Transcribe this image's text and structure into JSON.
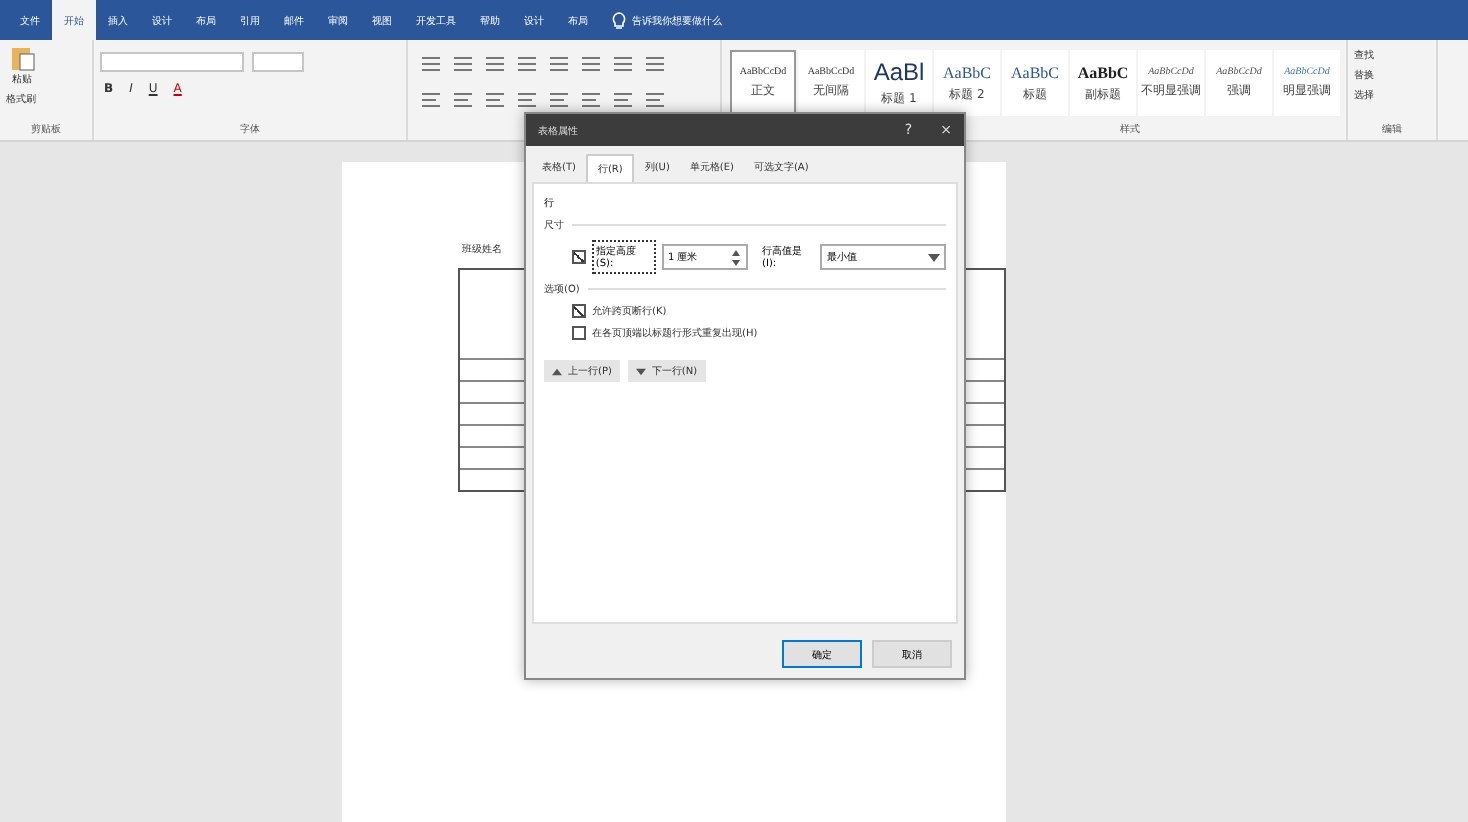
{
  "menu_tabs": [
    {
      "label": "文件",
      "selected": false
    },
    {
      "label": "开始",
      "selected": true
    },
    {
      "label": "插入",
      "selected": false
    },
    {
      "label": "设计",
      "selected": false
    },
    {
      "label": "布局",
      "selected": false
    },
    {
      "label": "引用",
      "selected": false
    },
    {
      "label": "邮件",
      "selected": false
    },
    {
      "label": "审阅",
      "selected": false
    },
    {
      "label": "视图",
      "selected": false
    },
    {
      "label": "开发工具",
      "selected": false
    },
    {
      "label": "帮助",
      "selected": false
    },
    {
      "label": "设计",
      "selected": false
    },
    {
      "label": "布局",
      "selected": false
    }
  ],
  "tell_me": "告诉我你想要做什么",
  "ribbon": {
    "paste": "粘贴",
    "format_painter": "格式刷",
    "clipboard_group": "剪贴板",
    "font_buttons": [
      "B",
      "I",
      "U",
      "A"
    ],
    "font_group": "字体",
    "styles": [
      {
        "preview": "AaBbCcDd",
        "name": "正文",
        "selected": true,
        "kind": "small"
      },
      {
        "preview": "AaBbCcDd",
        "name": "无间隔",
        "selected": false,
        "kind": "small"
      },
      {
        "preview": "AaBl",
        "name": "标题 1",
        "selected": false,
        "kind": "heading"
      },
      {
        "preview": "AaBbC",
        "name": "标题 2",
        "selected": false,
        "kind": "medium"
      },
      {
        "preview": "AaBbC",
        "name": "标题",
        "selected": false,
        "kind": "medium"
      },
      {
        "preview": "AaBbC",
        "name": "副标题",
        "selected": false,
        "kind": "bold"
      },
      {
        "preview": "AaBbCcDd",
        "name": "不明显强调",
        "selected": false,
        "kind": "italic"
      },
      {
        "preview": "AaBbCcDd",
        "name": "强调",
        "selected": false,
        "kind": "italic"
      },
      {
        "preview": "AaBbCcDd",
        "name": "明显强调",
        "selected": false,
        "kind": "accent"
      }
    ],
    "styles_group": "样式",
    "editing": [
      "查找",
      "替换",
      "选择"
    ],
    "editing_group": "编辑"
  },
  "document": {
    "table_caption": "班级姓名"
  },
  "dialog": {
    "title": "表格属性",
    "help": "?",
    "close": "×",
    "tabs": [
      {
        "label": "表格(T)",
        "selected": false
      },
      {
        "label": "行(R)",
        "selected": true
      },
      {
        "label": "列(U)",
        "selected": false
      },
      {
        "label": "单元格(E)",
        "selected": false
      },
      {
        "label": "可选文字(A)",
        "selected": false
      }
    ],
    "section": "行",
    "size_label": "尺寸",
    "specify_height": {
      "label": "指定高度(S):",
      "checked": true
    },
    "height_value": "1 厘米",
    "row_height_label": "行高值是(I):",
    "row_height_value": "最小值",
    "options_label": "选项(O)",
    "options": [
      {
        "label": "允许跨页断行(K)",
        "checked": true
      },
      {
        "label": "在各页顶端以标题行形式重复出现(H)",
        "checked": false
      }
    ],
    "prev_row": "上一行(P)",
    "next_row": "下一行(N)",
    "ok": "确定",
    "cancel": "取消"
  }
}
